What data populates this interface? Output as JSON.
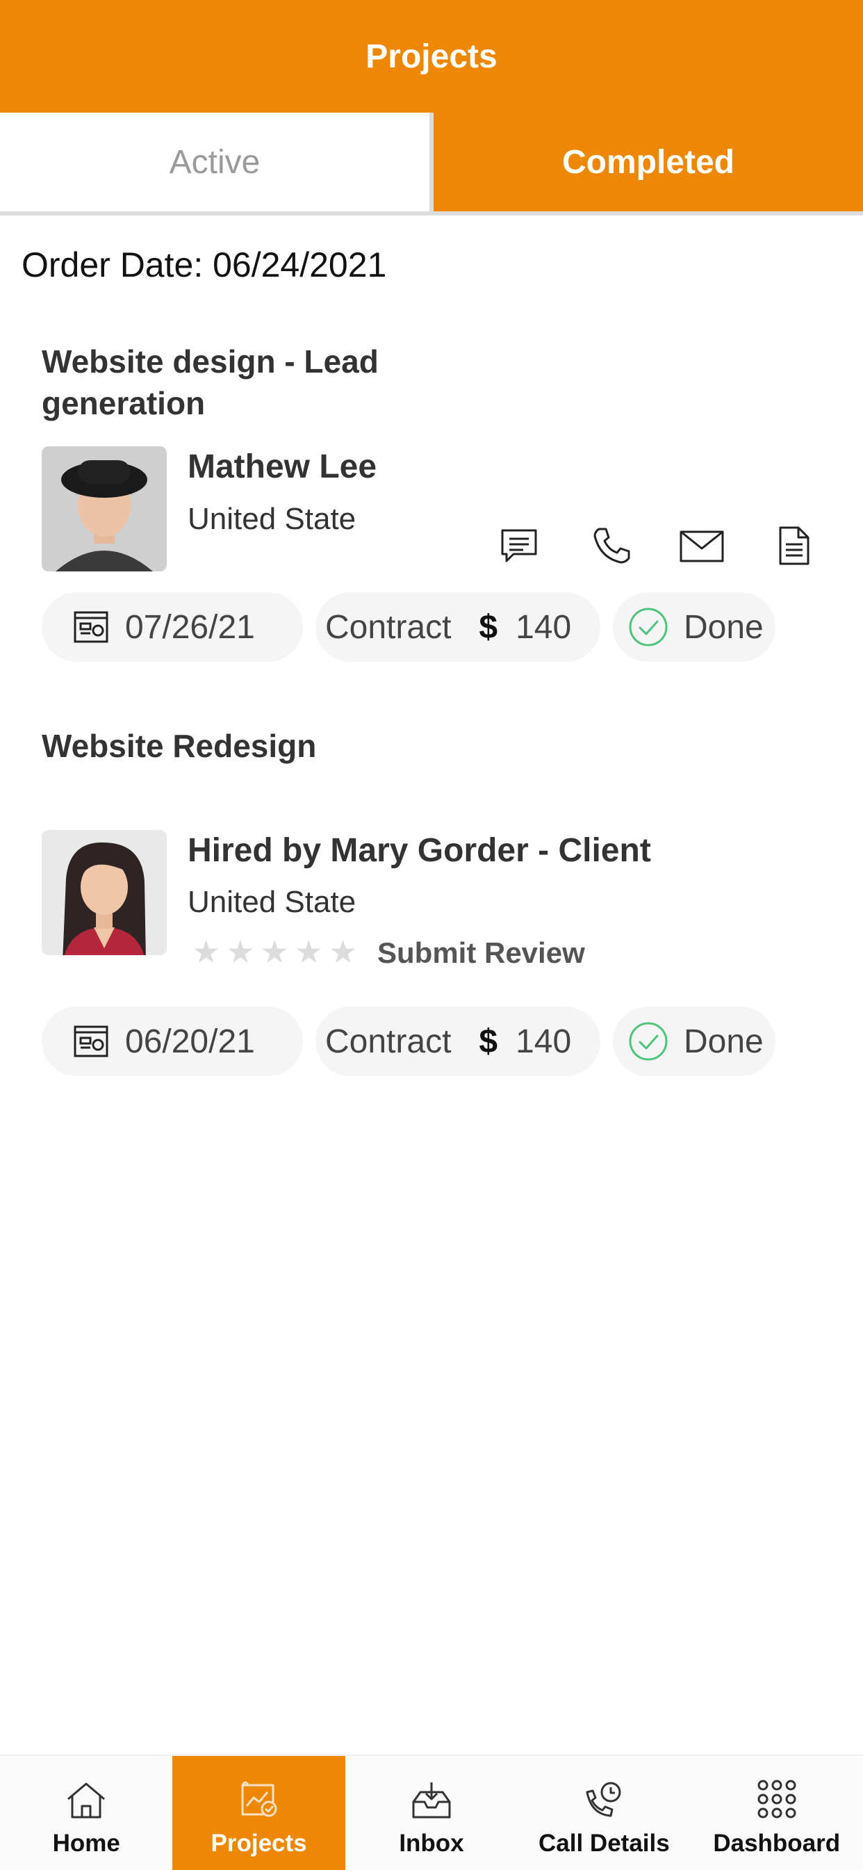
{
  "header": {
    "title": "Projects"
  },
  "tabs": {
    "active_label": "Active",
    "completed_label": "Completed"
  },
  "order_date": "Order Date: 06/24/2021",
  "projects": [
    {
      "title": "Website design - Lead generation",
      "person_name": "Mathew Lee",
      "location": "United State",
      "date": "07/26/21",
      "contract_label": "Contract",
      "currency": "$",
      "amount": "140",
      "status": "Done"
    },
    {
      "title": "Website Redesign",
      "person_name": "Hired by Mary Gorder - Client",
      "location": "United State",
      "rating": 0,
      "rating_max": 5,
      "review_label": "Submit Review",
      "date": "06/20/21",
      "contract_label": "Contract",
      "currency": "$",
      "amount": "140",
      "status": "Done"
    }
  ],
  "nav": {
    "items": [
      {
        "label": "Home",
        "icon": "home-icon"
      },
      {
        "label": "Projects",
        "icon": "projects-icon"
      },
      {
        "label": "Inbox",
        "icon": "inbox-icon"
      },
      {
        "label": "Call Details",
        "icon": "call-details-icon"
      },
      {
        "label": "Dashboard",
        "icon": "dashboard-grid-icon"
      }
    ],
    "active_index": 1
  },
  "colors": {
    "accent": "#EE8704",
    "done_green": "#4CC47A",
    "pill_bg": "#F5F5F5"
  }
}
